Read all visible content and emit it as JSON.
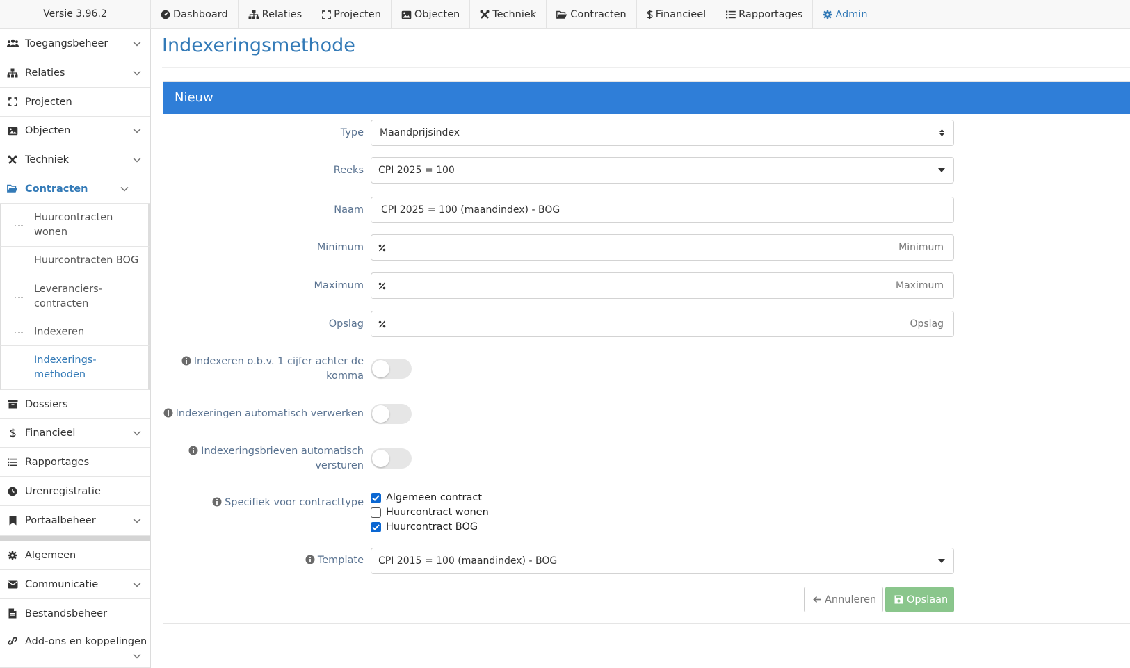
{
  "header": {
    "version": "Versie 3.96.2",
    "nav": [
      {
        "label": "Dashboard",
        "icon": "dashboard-icon"
      },
      {
        "label": "Relaties",
        "icon": "sitemap-icon"
      },
      {
        "label": "Projecten",
        "icon": "expand-icon"
      },
      {
        "label": "Objecten",
        "icon": "image-icon"
      },
      {
        "label": "Techniek",
        "icon": "tools-icon"
      },
      {
        "label": "Contracten",
        "icon": "folder-open-icon"
      },
      {
        "label": "Financieel",
        "icon": "dollar-icon"
      },
      {
        "label": "Rapportages",
        "icon": "list-icon"
      },
      {
        "label": "Admin",
        "icon": "gear-icon",
        "active": true
      }
    ]
  },
  "sidebar": {
    "items": [
      {
        "label": "Toegangsbeheer"
      },
      {
        "label": "Relaties"
      },
      {
        "label": "Projecten"
      },
      {
        "label": "Objecten"
      },
      {
        "label": "Techniek"
      },
      {
        "label": "Contracten"
      },
      {
        "label": "Dossiers"
      },
      {
        "label": "Financieel"
      },
      {
        "label": "Rapportages"
      },
      {
        "label": "Urenregistratie"
      },
      {
        "label": "Portaalbeheer"
      },
      {
        "label": "Algemeen"
      },
      {
        "label": "Communicatie"
      },
      {
        "label": "Bestandsbeheer"
      },
      {
        "label": "Add-ons en koppelingen"
      }
    ],
    "contracten_sub": [
      {
        "label": "Huurcontracten wonen"
      },
      {
        "label": "Huurcontracten BOG"
      },
      {
        "label": "Leveranciers-contracten"
      },
      {
        "label": "Indexeren"
      },
      {
        "label": "Indexerings-methoden"
      }
    ]
  },
  "page": {
    "title": "Indexeringsmethode",
    "panel_title": "Nieuw"
  },
  "form": {
    "type": {
      "label": "Type",
      "value": "Maandprijsindex"
    },
    "reeks": {
      "label": "Reeks",
      "value": "CPI 2025 = 100"
    },
    "naam": {
      "label": "Naam",
      "value": "CPI 2025 = 100 (maandindex) - BOG"
    },
    "minimum": {
      "label": "Minimum",
      "placeholder": "Minimum"
    },
    "maximum": {
      "label": "Maximum",
      "placeholder": "Maximum"
    },
    "opslag": {
      "label": "Opslag",
      "placeholder": "Opslag"
    },
    "toggle_decimal": {
      "label": "Indexeren o.b.v. 1 cijfer achter de komma",
      "on": false
    },
    "toggle_auto": {
      "label": "Indexeringen automatisch verwerken",
      "on": false
    },
    "toggle_letters": {
      "label": "Indexeringsbrieven automatisch versturen",
      "on": false
    },
    "contracttype": {
      "label": "Specifiek voor contracttype",
      "options": [
        {
          "label": "Algemeen contract",
          "checked": true
        },
        {
          "label": "Huurcontract wonen",
          "checked": false
        },
        {
          "label": "Huurcontract BOG",
          "checked": true
        }
      ]
    },
    "template": {
      "label": "Template",
      "value": "CPI 2015 = 100 (maandindex) - BOG"
    },
    "cancel_label": "Annuleren",
    "save_label": "Opslaan"
  },
  "colors": {
    "accent": "#337ab7",
    "panel_header": "#2f7ed8",
    "save": "#8ac68c",
    "checkbox": "#0b67d2"
  }
}
